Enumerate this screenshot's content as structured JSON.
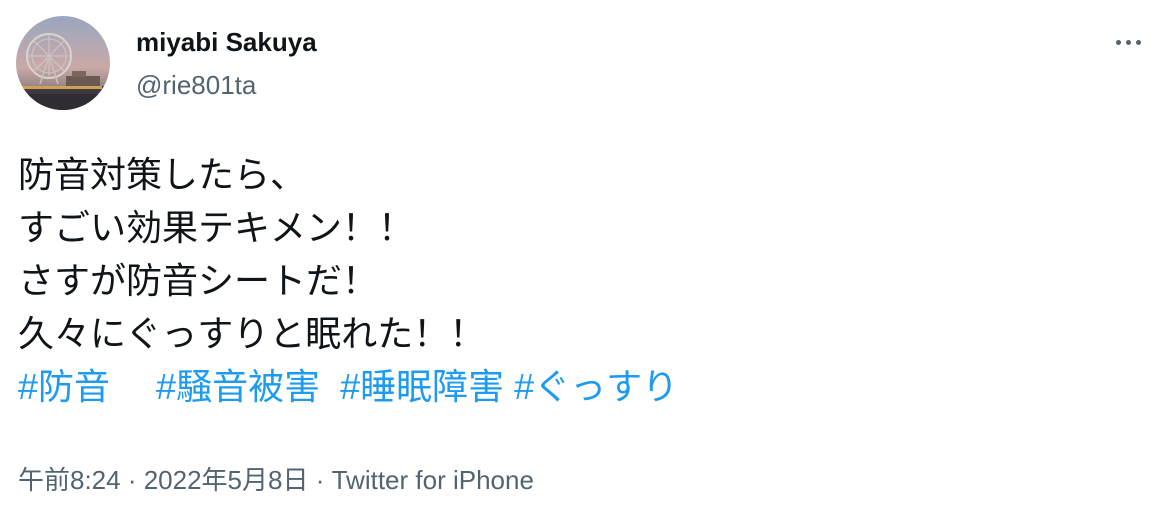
{
  "user": {
    "display_name": "miyabi Sakuya",
    "handle": "@rie801ta",
    "avatar_icon": "ferris-wheel-night-photo"
  },
  "more_icon": "ellipsis-icon",
  "tweet": {
    "lines": [
      "防音対策したら、",
      "すごい効果テキメン！！",
      "さすが防音シートだ！",
      "久々にぐっすりと眠れた！！"
    ],
    "hashtags": [
      "#防音",
      "#騒音被害",
      "#睡眠障害",
      "#ぐっすり"
    ],
    "link_color": "#1d9bf0"
  },
  "meta": {
    "time": "午前8:24",
    "date": "2022年5月8日",
    "separator": " · ",
    "source": "Twitter for iPhone"
  }
}
